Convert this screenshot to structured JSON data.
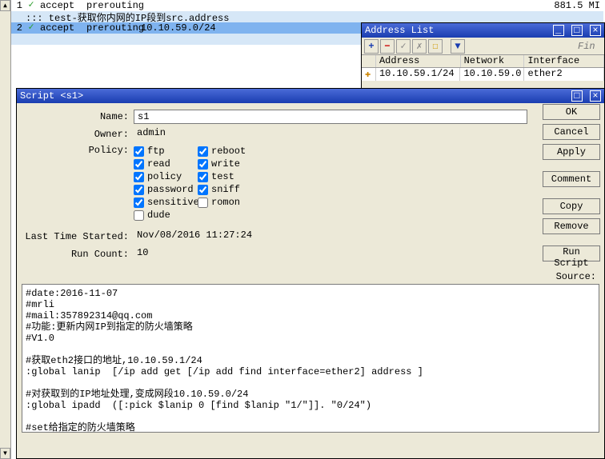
{
  "bg_table": {
    "r1": {
      "num": "1",
      "action": "accept",
      "chain": "prerouting",
      "right": "881.5 MI"
    },
    "r2": "::: test-获取你内网的IP段到src.address",
    "r3": {
      "num": "2",
      "action": "accept",
      "chain": "prerouting",
      "addr": "10.10.59.0/24"
    }
  },
  "addr_win": {
    "title": "Address List",
    "find": "Fin",
    "head": {
      "addr": "Address",
      "net": "Network",
      "iface": "Interface"
    },
    "row": {
      "addr": "10.10.59.1/24",
      "net": "10.10.59.0",
      "iface": "ether2"
    }
  },
  "script": {
    "title": "Script <s1>",
    "labels": {
      "name": "Name:",
      "owner": "Owner:",
      "policy": "Policy:",
      "lts": "Last Time Started:",
      "rc": "Run Count:",
      "src": "Source:"
    },
    "name": "s1",
    "owner": "admin",
    "lts": "Nov/08/2016 11:27:24",
    "rc": "10",
    "policies_col1": [
      "ftp",
      "read",
      "policy",
      "password",
      "sensitive",
      "dude"
    ],
    "policies_col2": [
      "reboot",
      "write",
      "test",
      "sniff",
      "romon"
    ],
    "buttons": {
      "ok": "OK",
      "cancel": "Cancel",
      "apply": "Apply",
      "comment": "Comment",
      "copy": "Copy",
      "remove": "Remove",
      "run": "Run Script"
    },
    "source": "#date:2016-11-07\n#mrli\n#mail:357892314@qq.com\n#功能:更新内网IP到指定的防火墙策略\n#V1.0\n\n#获取eth2接口的地址,10.10.59.1/24\n:global lanip  [/ip add get [/ip add find interface=ether2] address ]\n\n#对获取到的IP地址处理,变成网段10.10.59.0/24\n:global ipadd  ([:pick $lanip 0 [find $lanip \"1/\"]]. \"0/24\")\n\n#set给指定的防火墙策略\n/ip fir man set [find comment~\"test\"] src-address=$lanip"
  }
}
